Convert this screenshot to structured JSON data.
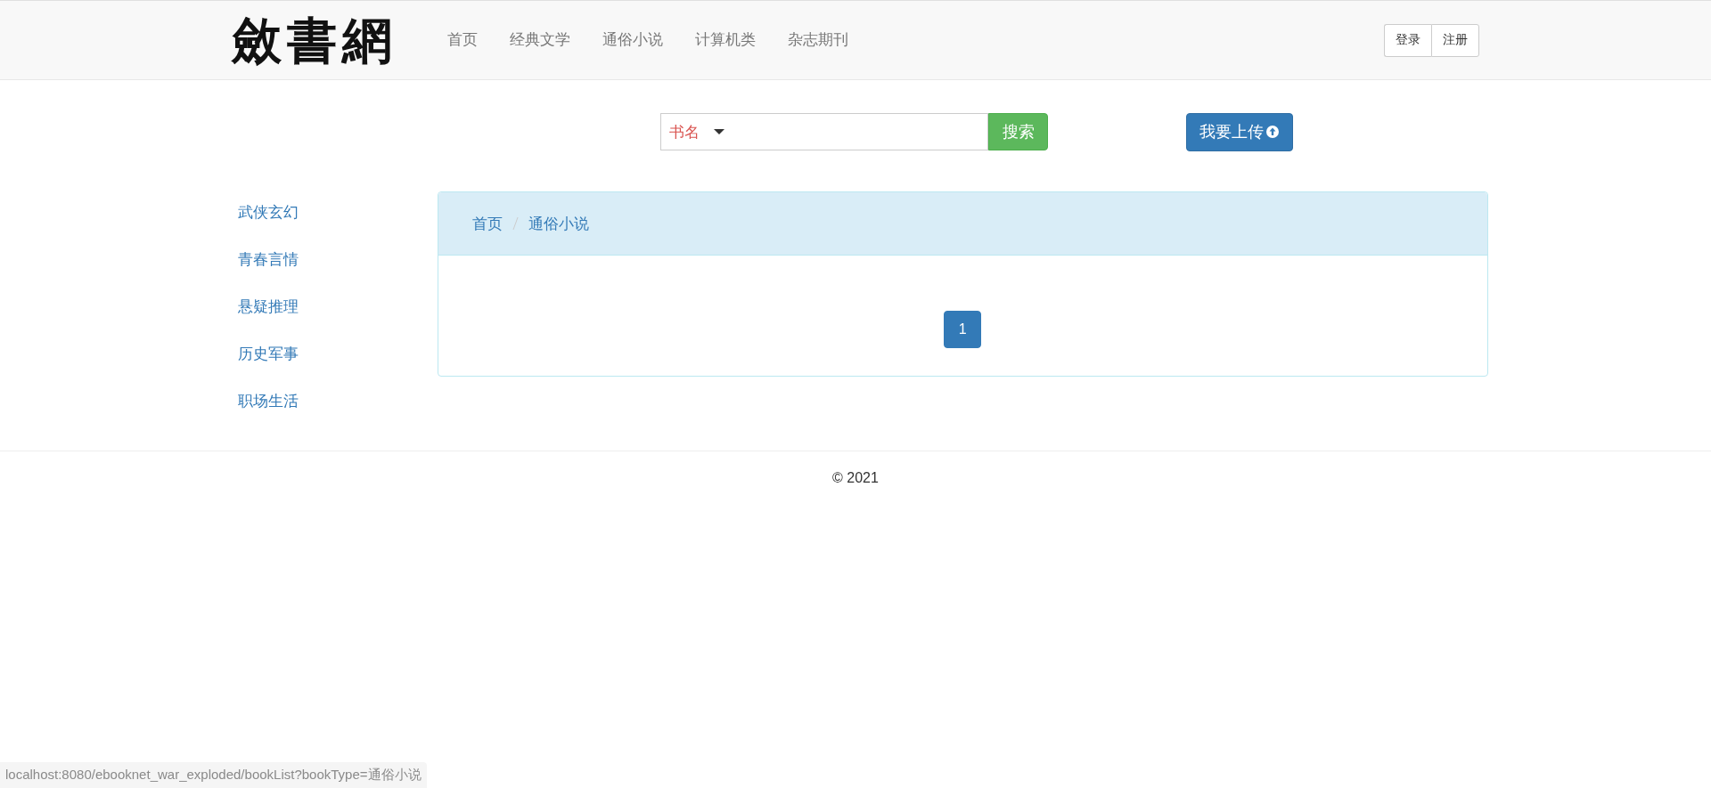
{
  "logo": "斂書網",
  "nav": [
    "首页",
    "经典文学",
    "通俗小说",
    "计算机类",
    "杂志期刊"
  ],
  "auth_buttons": [
    "登录",
    "注册"
  ],
  "search": {
    "field_type": "书名",
    "button": "搜索"
  },
  "upload_button": "我要上传",
  "sidebar": {
    "items": [
      "武侠玄幻",
      "青春言情",
      "悬疑推理",
      "历史军事",
      "职场生活"
    ]
  },
  "breadcrumb": [
    "首页",
    "通俗小说"
  ],
  "pagination": [
    {
      "label": "1",
      "selected": true
    }
  ],
  "footer": "© 2021",
  "status_bar": "localhost:8080/ebooknet_war_exploded/bookList?bookType=通俗小说"
}
